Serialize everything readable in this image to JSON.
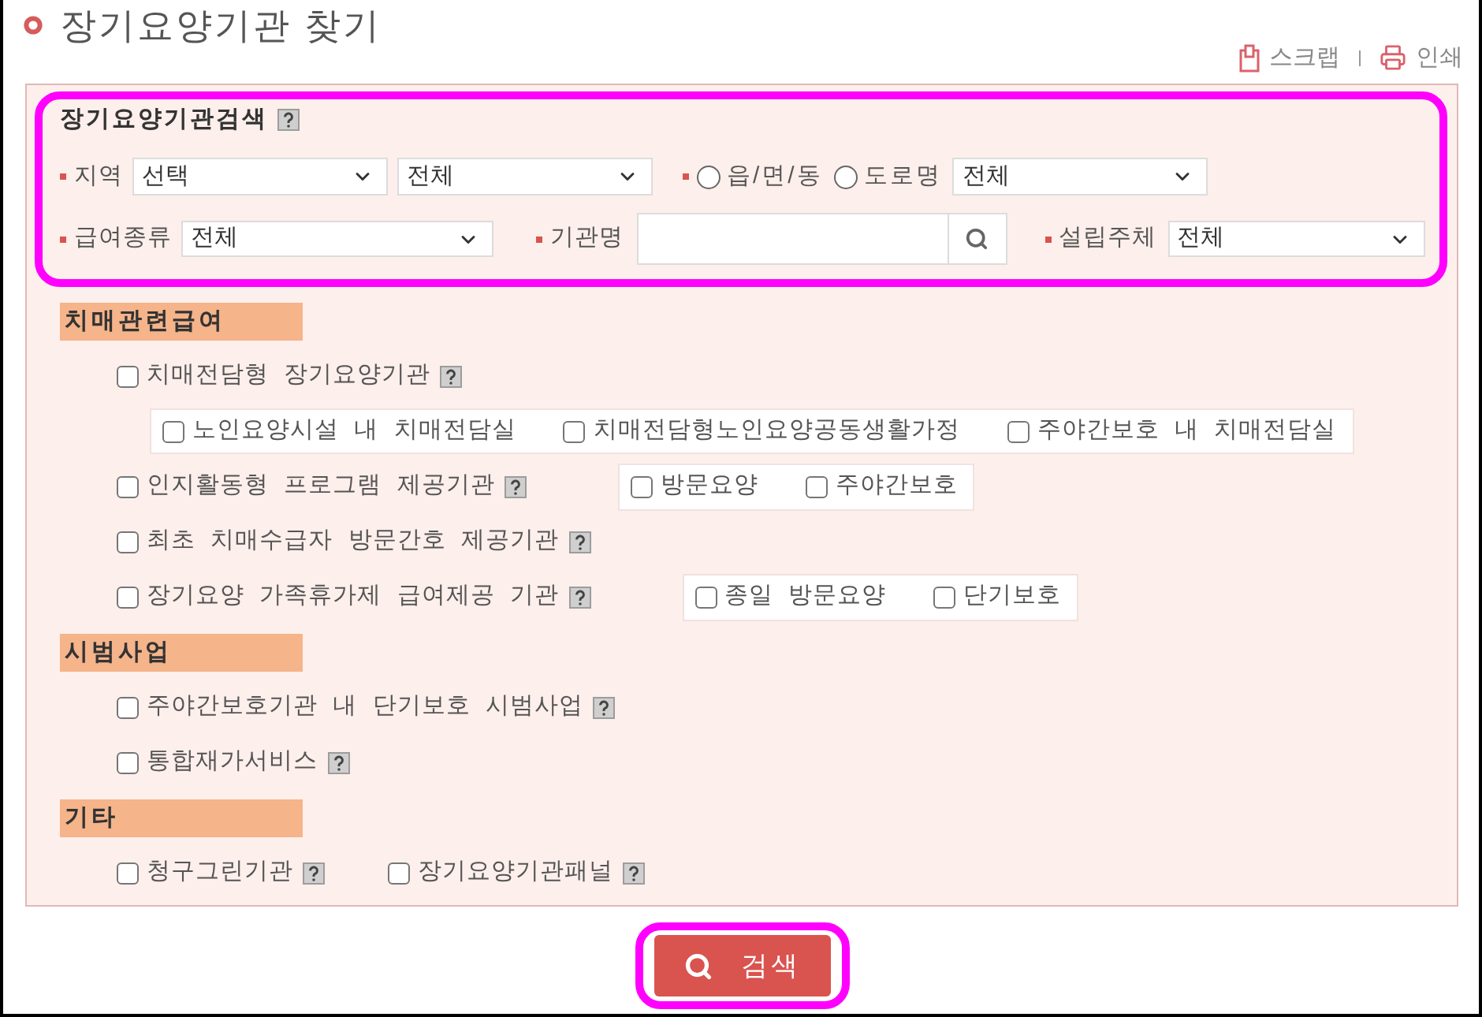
{
  "page": {
    "title": "장기요양기관 찾기",
    "actions": [
      {
        "kind": "scrap",
        "label": "스크랩"
      },
      {
        "kind": "print",
        "label": "인쇄"
      }
    ]
  },
  "search": {
    "highlighted": true,
    "title": "장기요양기관검색",
    "help": true,
    "region": {
      "label": "지역",
      "province": "선택",
      "district": "전체"
    },
    "address": {
      "options": [
        {
          "label": "읍/면/동",
          "selected": false
        },
        {
          "label": "도로명",
          "selected": false
        }
      ],
      "value": "전체"
    },
    "benefit_type": {
      "label": "급여종류",
      "value": "전체"
    },
    "institution_name": {
      "label": "기관명"
    },
    "founder": {
      "label": "설립주체",
      "value": "전체"
    }
  },
  "sections": [
    {
      "title": "치매관련급여",
      "kind": "stacked",
      "items": [
        {
          "label": "치매전담형 장기요양기관",
          "checked": false,
          "help": true,
          "kind": "suboptions_below",
          "options": [
            {
              "label": "노인요양시설 내 치매전담실",
              "checked": false
            },
            {
              "label": "치매전담형노인요양공동생활가정",
              "checked": false
            },
            {
              "label": "주야간보호 내 치매전담실",
              "checked": false
            }
          ]
        },
        {
          "label": "인지활동형 프로그램 제공기관",
          "checked": false,
          "help": true,
          "kind": "suboptions_inline",
          "options": [
            {
              "label": "방문요양",
              "checked": false
            },
            {
              "label": "주야간보호",
              "checked": false
            }
          ]
        },
        {
          "label": "최초 치매수급자 방문간호 제공기관",
          "checked": false,
          "help": true,
          "kind": "plain"
        },
        {
          "label": "장기요양 가족휴가제 급여제공 기관",
          "checked": false,
          "help": true,
          "kind": "suboptions_inline",
          "options": [
            {
              "label": "종일 방문요양",
              "checked": false
            },
            {
              "label": "단기보호",
              "checked": false
            }
          ]
        }
      ]
    },
    {
      "title": "시범사업",
      "kind": "stacked",
      "items": [
        {
          "label": "주야간보호기관 내 단기보호 시범사업",
          "checked": false,
          "help": true,
          "kind": "plain"
        },
        {
          "label": "통합재가서비스",
          "checked": false,
          "help": true,
          "kind": "plain"
        }
      ]
    },
    {
      "title": "기타",
      "kind": "inline",
      "items": [
        {
          "label": "청구그린기관",
          "checked": false,
          "help": true,
          "kind": "plain"
        },
        {
          "label": "장기요양기관패널",
          "checked": false,
          "help": true,
          "kind": "plain"
        }
      ]
    }
  ],
  "submit": {
    "label": "검색",
    "highlighted": true
  }
}
